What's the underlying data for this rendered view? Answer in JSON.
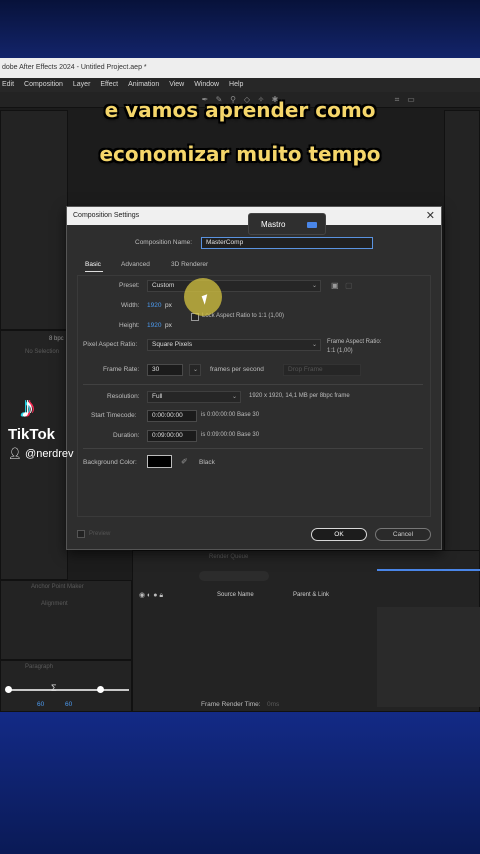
{
  "app": {
    "title": "dobe After Effects 2024 - Untitled Project.aep *",
    "menu": [
      "Edit",
      "Composition",
      "Layer",
      "Effect",
      "Animation",
      "View",
      "Window",
      "Help"
    ]
  },
  "captions": {
    "line1": "e vamos aprender como",
    "line2": "economizar muito tempo"
  },
  "tiktok": {
    "brand": "TikTok",
    "handle": "@nerdrev"
  },
  "tooltip": {
    "label": "Mastro"
  },
  "dialog": {
    "title": "Composition Settings",
    "comp_name_label": "Composition Name:",
    "comp_name_value": "MasterComp",
    "tabs": [
      "Basic",
      "Advanced",
      "3D Renderer"
    ],
    "preset_label": "Preset:",
    "preset_value": "Custom",
    "width_label": "Width:",
    "width_value": "1920",
    "width_unit": "px",
    "height_label": "Height:",
    "height_value": "1920",
    "height_unit": "px",
    "lock_aspect_label": "Lock Aspect Ratio to 1:1 (1,00)",
    "pixel_aspect_label": "Pixel Aspect Ratio:",
    "pixel_aspect_value": "Square Pixels",
    "frame_aspect_label": "Frame Aspect Ratio:",
    "frame_aspect_value": "1:1 (1,00)",
    "frame_rate_label": "Frame Rate:",
    "frame_rate_value": "30",
    "frame_rate_unit": "frames per second",
    "drop_frame": "Drop Frame",
    "resolution_label": "Resolution:",
    "resolution_value": "Full",
    "resolution_info": "1920 x 1920, 14,1 MB per 8bpc frame",
    "start_tc_label": "Start Timecode:",
    "start_tc_value": "0:00:00:00",
    "start_tc_info": "is 0:00:00:00  Base 30",
    "duration_label": "Duration:",
    "duration_value": "0:09:00:00",
    "duration_info": "is 0:09:00:00  Base 30",
    "bg_color_label": "Background Color:",
    "bg_color_name": "Black",
    "bg_color_hex": "#000000",
    "preview_label": "Preview",
    "ok_label": "OK",
    "cancel_label": "Cancel"
  },
  "background_ui": {
    "bpc": "8 bpc",
    "no_selection": "No Selection",
    "panel_render_queue": "Render Queue",
    "col_source_name": "Source Name",
    "col_parent_link": "Parent & Link",
    "frame_render_time_label": "Frame Render Time:",
    "frame_render_time_value": "0ms",
    "audio_values": [
      "60",
      "60"
    ],
    "left_panel_labels": [
      "Anchor Point Maker",
      "Alignment",
      "Paragraph"
    ]
  },
  "colors": {
    "accent_blue": "#4d9bf0",
    "caption_yellow": "#f5d66a",
    "background_navy": "#0b1a4d"
  }
}
